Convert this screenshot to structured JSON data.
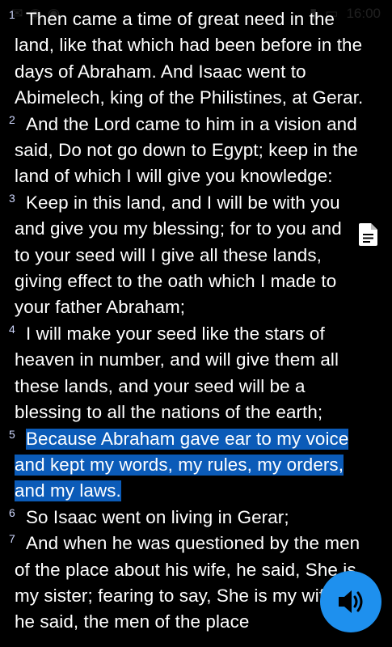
{
  "status_bar": {
    "time": "16:00"
  },
  "verses": [
    {
      "number": "1",
      "text": "Then came a time of great need in the land, like that which had been before in the days of Abraham. And Isaac went to Abimelech, king of the Philistines, at Gerar.",
      "highlighted": false
    },
    {
      "number": "2",
      "text": "And the Lord came to him in a vision and said, Do not go down to Egypt; keep in the land of which I will give you knowledge:",
      "highlighted": false
    },
    {
      "number": "3",
      "text": "Keep in this land, and I will be with you and give you my blessing; for to you and to your seed will I give all these lands, giving effect to the oath which I made to your father Abraham;",
      "highlighted": false
    },
    {
      "number": "4",
      "text": "I will make your seed like the stars of heaven in number, and will give them all these lands, and your seed will be a blessing to all the nations of the earth;",
      "highlighted": false
    },
    {
      "number": "5",
      "text": "Because Abraham gave ear to my voice and kept my words, my rules, my orders, and my laws.",
      "highlighted": true
    },
    {
      "number": "6",
      "text": "So Isaac went on living in Gerar;",
      "highlighted": false
    },
    {
      "number": "7",
      "text": "And when he was questioned by the men of the place about his wife, he said, She is my sister; fearing to say, She is my wife, for he said, the men of the place",
      "highlighted": false
    }
  ],
  "icons": {
    "note": "note-icon",
    "audio": "speaker-icon"
  },
  "colors": {
    "background": "#000000",
    "text": "#ffffff",
    "highlight": "#0b5bb8",
    "fab": "#1e90ee"
  }
}
